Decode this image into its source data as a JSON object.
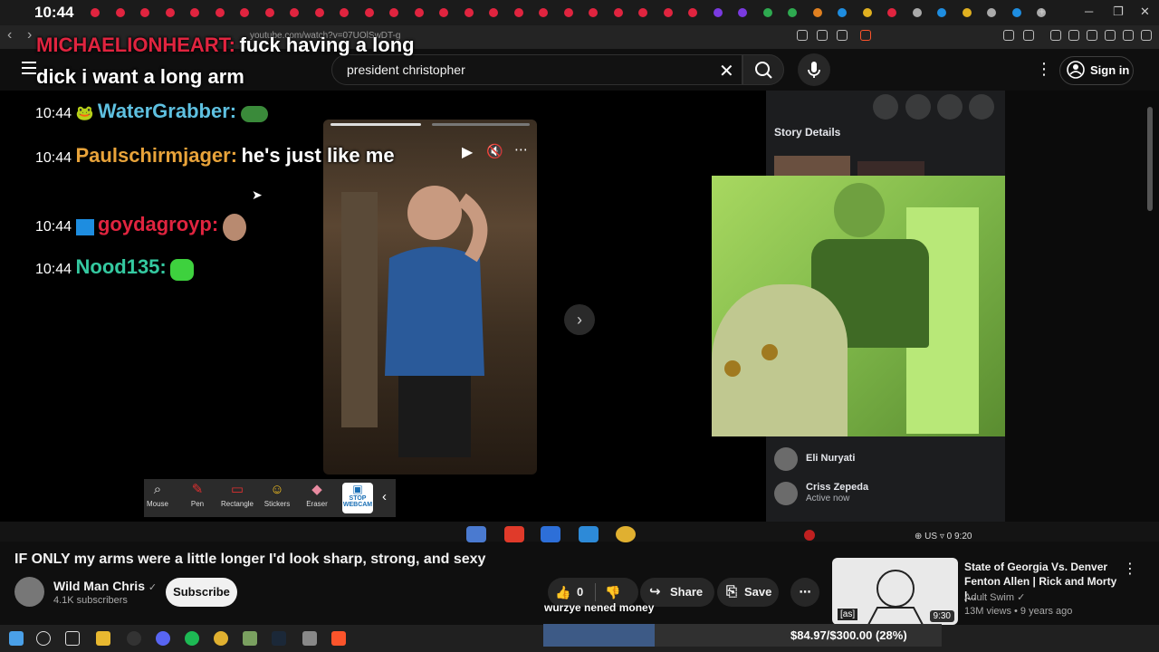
{
  "browser": {
    "url": "youtube.com/watch?v=07UOlSwDT-g",
    "clock_overlay": "10:44"
  },
  "youtube_header": {
    "search_value": "president christopher",
    "sign_in_label": "Sign in"
  },
  "chat": [
    {
      "time": "",
      "user": "MICHAELIONHEART:",
      "user_color": "#e0243f",
      "message": "fuck having a long dick i want a long arm"
    },
    {
      "time": "10:44",
      "user": "WaterGrabber:",
      "user_color": "#5ec0e0",
      "message": ""
    },
    {
      "time": "10:44",
      "user": "Paulschirmjager:",
      "user_color": "#e8a33a",
      "message": "he's just like me"
    },
    {
      "time": "10:44",
      "user": "goydagroyp:",
      "user_color": "#e0243f",
      "message": ""
    },
    {
      "time": "10:44",
      "user": "Nood135:",
      "user_color": "#34c9a0",
      "message": ""
    }
  ],
  "facebook": {
    "story_title": "Story Details",
    "contacts": [
      {
        "name": "Eli Nuryati",
        "status": ""
      },
      {
        "name": "Criss Zepeda",
        "status": "Active now"
      }
    ],
    "status_bar": {
      "region": "US",
      "count": "0",
      "time": "9:20"
    }
  },
  "draw_tools": {
    "mouse": "Mouse",
    "pen": "Pen",
    "rectangle": "Rectangle",
    "stickers": "Stickers",
    "eraser": "Eraser",
    "stop_webcam": "STOP WEBCAM"
  },
  "video": {
    "title": "IF ONLY my arms were a little longer I'd look sharp, strong, and sexy",
    "channel": "Wild Man Chris",
    "subscribers": "4.1K subscribers",
    "subscribe_label": "Subscribe",
    "likes": "0",
    "share_label": "Share",
    "save_label": "Save"
  },
  "overlay_text": "wurzye nened money",
  "recommended": {
    "title": "State of Georgia Vs. Denver Fenton Allen | Rick and Morty |...",
    "channel": "Adult Swim",
    "meta": "13M views • 9 years ago",
    "duration": "9:30",
    "thumb_tag": "[as]"
  },
  "donation": {
    "text": "$84.97/$300.00 (28%)",
    "progress": 0.28
  },
  "colors": {
    "accent_red": "#e0243f",
    "donation_fill": "#3d5a86"
  }
}
